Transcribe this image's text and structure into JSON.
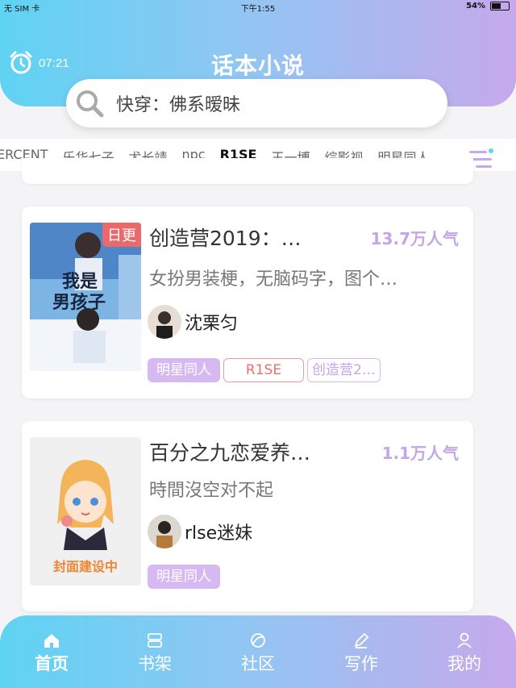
{
  "status": {
    "carrier": "无 SIM 卡",
    "time": "下午1:55",
    "battery": "54%"
  },
  "header": {
    "alarm_time": "07:21",
    "title": "话本小说"
  },
  "search": {
    "text": "快穿：佛系暧昧"
  },
  "tabs": [
    "ERCENT",
    "乐华七子",
    "尤长靖",
    "npc",
    "R1SE",
    "王一博",
    "综影视",
    "明星同人"
  ],
  "active_tab": "R1SE",
  "books": [
    {
      "title": "创造营2019：…",
      "popularity": "13.7万人气",
      "summary": "女扮男装梗，无脑码字，图个…",
      "author": "沈栗匀",
      "badge": "日更",
      "cover_text": [
        "我是",
        "男孩子"
      ],
      "tags": [
        "明星同人",
        "R1SE",
        "创造营2…"
      ]
    },
    {
      "title": "百分之九恋爱养…",
      "popularity": "1.1万人气",
      "summary": "時間沒空对不起",
      "author": "rlse迷妹",
      "cover_text": "封面建设中",
      "tags": [
        "明星同人"
      ]
    }
  ],
  "nav": [
    {
      "label": "首页",
      "icon": "home-icon"
    },
    {
      "label": "书架",
      "icon": "bookshelf-icon"
    },
    {
      "label": "社区",
      "icon": "community-icon"
    },
    {
      "label": "写作",
      "icon": "pencil-icon"
    },
    {
      "label": "我的",
      "icon": "user-icon"
    }
  ],
  "colors": {
    "accent_purple": "#c3a6ea",
    "gradient_start": "#5fd3f3",
    "gradient_end": "#c6a9ec",
    "daily_red": "#e86a6a"
  }
}
